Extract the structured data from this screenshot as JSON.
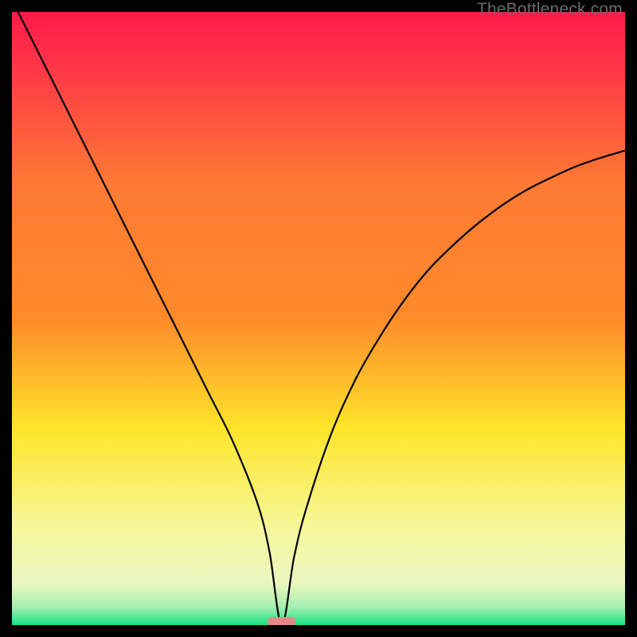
{
  "watermark": "TheBottleneck.com",
  "chart_data": {
    "type": "line",
    "title": "",
    "xlabel": "",
    "ylabel": "",
    "xlim": [
      0,
      100
    ],
    "ylim": [
      0,
      100
    ],
    "curve_minimum_x": 44,
    "marker": {
      "x": 44,
      "y": 0,
      "color": "#e38a88"
    },
    "background_gradient": {
      "top": "#ff1a4a",
      "upper_mid": "#ff8a2a",
      "mid": "#ffe529",
      "lower_mid": "#f5f8a0",
      "bottom": "#17e387"
    },
    "series": [
      {
        "name": "bottleneck-curve",
        "x": [
          0,
          4,
          8,
          12,
          16,
          20,
          24,
          28,
          32,
          36,
          40,
          42,
          44,
          46,
          48,
          52,
          56,
          60,
          64,
          68,
          72,
          76,
          80,
          84,
          88,
          92,
          96,
          100
        ],
        "y": [
          102,
          94,
          86,
          78,
          70,
          62,
          54,
          46,
          38,
          30,
          20,
          12,
          0,
          11,
          19,
          31,
          40,
          47,
          53,
          58,
          62,
          65.5,
          68.5,
          71,
          73,
          74.8,
          76.2,
          77.4
        ]
      }
    ]
  }
}
